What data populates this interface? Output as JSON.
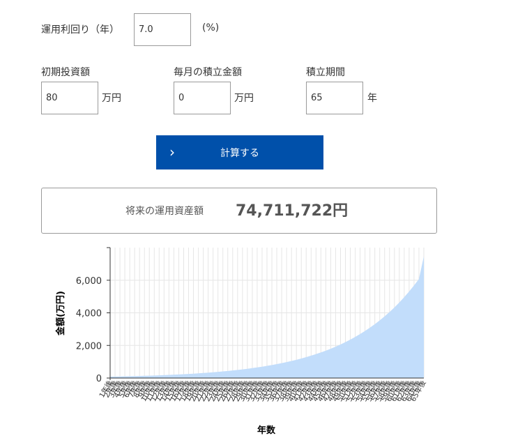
{
  "form": {
    "rate_label": "運用利回り（年）",
    "rate_value": "7.0",
    "rate_unit": "(%)",
    "initial_label": "初期投資額",
    "initial_value": "80",
    "initial_unit": "万円",
    "monthly_label": "毎月の積立金額",
    "monthly_value": "0",
    "monthly_unit": "万円",
    "period_label": "積立期間",
    "period_value": "65",
    "period_unit": "年"
  },
  "button": {
    "label": "計算する",
    "icon": "chevron-right-icon"
  },
  "result": {
    "label": "将来の運用資産額",
    "value": "74,711,722円"
  },
  "colors": {
    "accent": "#0050aa",
    "area_fill": "#c2ddfb"
  },
  "chart_data": {
    "type": "area",
    "x": [
      1,
      2,
      3,
      4,
      5,
      6,
      7,
      8,
      9,
      10,
      11,
      12,
      13,
      14,
      15,
      16,
      17,
      18,
      19,
      20,
      21,
      22,
      23,
      24,
      25,
      26,
      27,
      28,
      29,
      30,
      31,
      32,
      33,
      34,
      35,
      36,
      37,
      38,
      39,
      40,
      41,
      42,
      43,
      44,
      45,
      46,
      47,
      48,
      49,
      50,
      51,
      52,
      53,
      54,
      55,
      56,
      57,
      58,
      59,
      60,
      61,
      62,
      63,
      64,
      65
    ],
    "x_tick_suffix": "年後",
    "series": [
      {
        "values": [
          86,
          92,
          98,
          105,
          112,
          120,
          128,
          137,
          147,
          157,
          168,
          180,
          193,
          206,
          221,
          236,
          253,
          270,
          289,
          310,
          331,
          354,
          379,
          406,
          434,
          465,
          497,
          532,
          569,
          609,
          652,
          697,
          746,
          798,
          854,
          914,
          978,
          1046,
          1120,
          1198,
          1282,
          1372,
          1468,
          1570,
          1680,
          1798,
          1924,
          2058,
          2202,
          2357,
          2522,
          2698,
          2887,
          3089,
          3305,
          3537,
          3784,
          4049,
          4333,
          4636,
          4960,
          5308,
          5679,
          6077,
          7471
        ]
      }
    ],
    "xlabel": "年数",
    "ylabel": "金額(万円)",
    "ylim": [
      0,
      8000
    ],
    "yticks": [
      0,
      2000,
      4000,
      6000
    ],
    "ytick_labels": [
      "0",
      "2,000",
      "4,000",
      "6,000"
    ],
    "grid": true,
    "legend": "none"
  }
}
